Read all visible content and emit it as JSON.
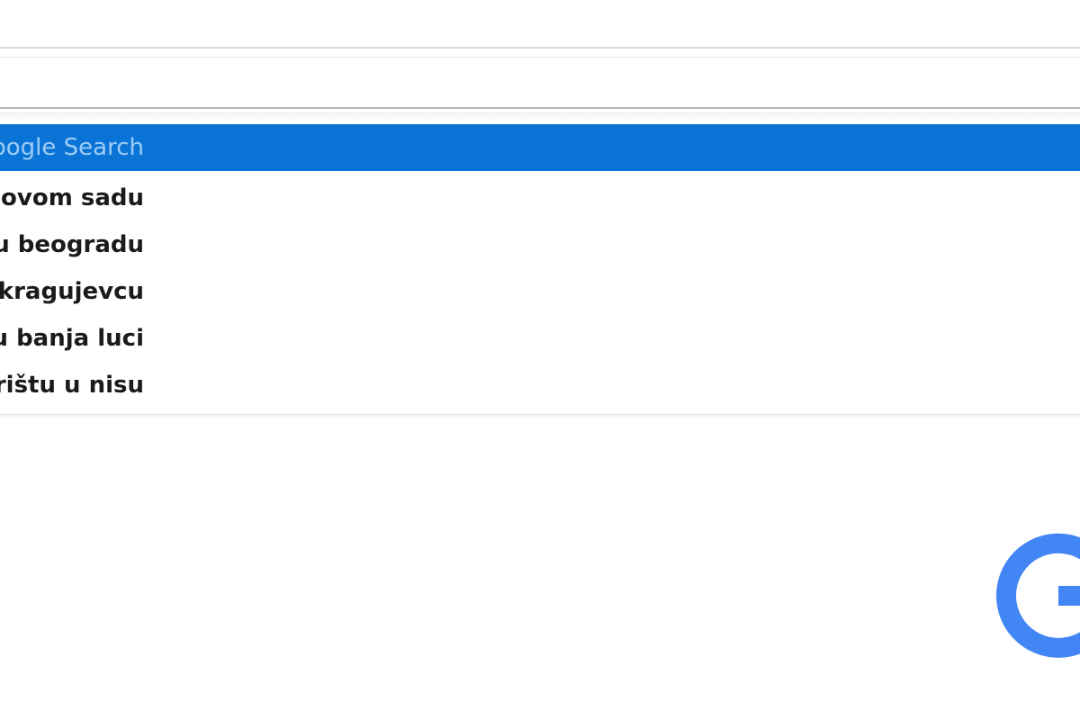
{
  "address_bar": {
    "value": ""
  },
  "suggestions": [
    {
      "label": "Search with Google Search",
      "selected": true
    },
    {
      "label": "pozorište u novom sadu",
      "selected": false
    },
    {
      "label": "pozorište u beogradu",
      "selected": false
    },
    {
      "label": "pozorištu u kragujevcu",
      "selected": false
    },
    {
      "label": "pozorištu u banja luci",
      "selected": false
    },
    {
      "label": "pozorištu u nisu",
      "selected": false
    }
  ],
  "logo": {
    "icon": "google-g-icon",
    "color": "#4285f4"
  },
  "colors": {
    "selection": "#0a74d6",
    "selection_text": "#9dccf5",
    "suggestion_text": "#1b1b1b"
  }
}
